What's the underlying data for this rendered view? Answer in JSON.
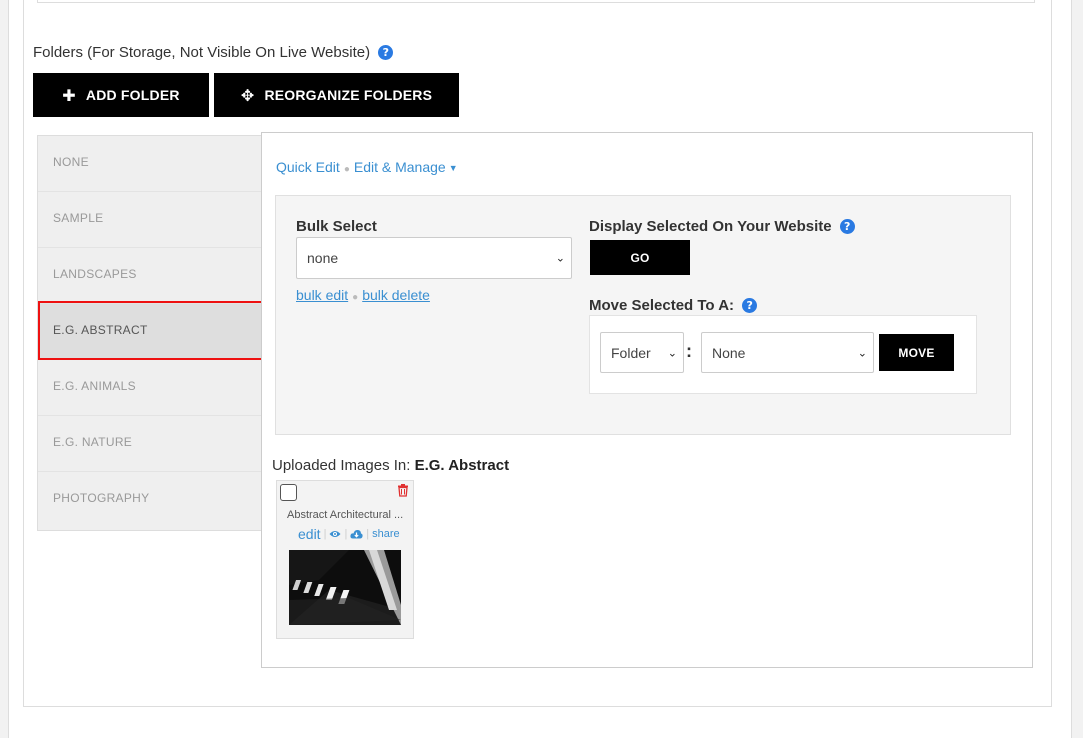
{
  "folders_heading": "Folders (For Storage, Not Visible On Live Website)",
  "help_glyph": "?",
  "buttons": {
    "add_folder": "ADD FOLDER",
    "add_folder_icon": "plus-icon",
    "reorganize": "REORGANIZE FOLDERS",
    "reorganize_icon": "move-arrows-icon"
  },
  "sidebar": {
    "items": [
      {
        "label": "NONE"
      },
      {
        "label": "SAMPLE"
      },
      {
        "label": "LANDSCAPES"
      },
      {
        "label": "E.G. ABSTRACT",
        "active": true
      },
      {
        "label": "E.G. ANIMALS"
      },
      {
        "label": "E.G. NATURE"
      },
      {
        "label": "PHOTOGRAPHY"
      }
    ]
  },
  "panel": {
    "tab_quick_edit": "Quick Edit",
    "tab_edit_manage": "Edit & Manage",
    "bulk_select_label": "Bulk Select",
    "bulk_select_value": "none",
    "bulk_edit": "bulk edit",
    "bulk_delete": "bulk delete",
    "display_selected_label": "Display Selected On Your Website",
    "go_button": "GO",
    "move_selected_label": "Move Selected To A:",
    "move_type_value": "Folder",
    "move_target_value": "None",
    "move_button": "MOVE",
    "uploaded_prefix": "Uploaded Images In:",
    "uploaded_folder": "E.G. Abstract"
  },
  "image_card": {
    "caption": "Abstract Architectural ...",
    "edit": "edit",
    "share": "share"
  },
  "colors": {
    "accent_blue": "#3a8fd1",
    "active_outline": "#e11111",
    "trash_red": "#e03030"
  }
}
